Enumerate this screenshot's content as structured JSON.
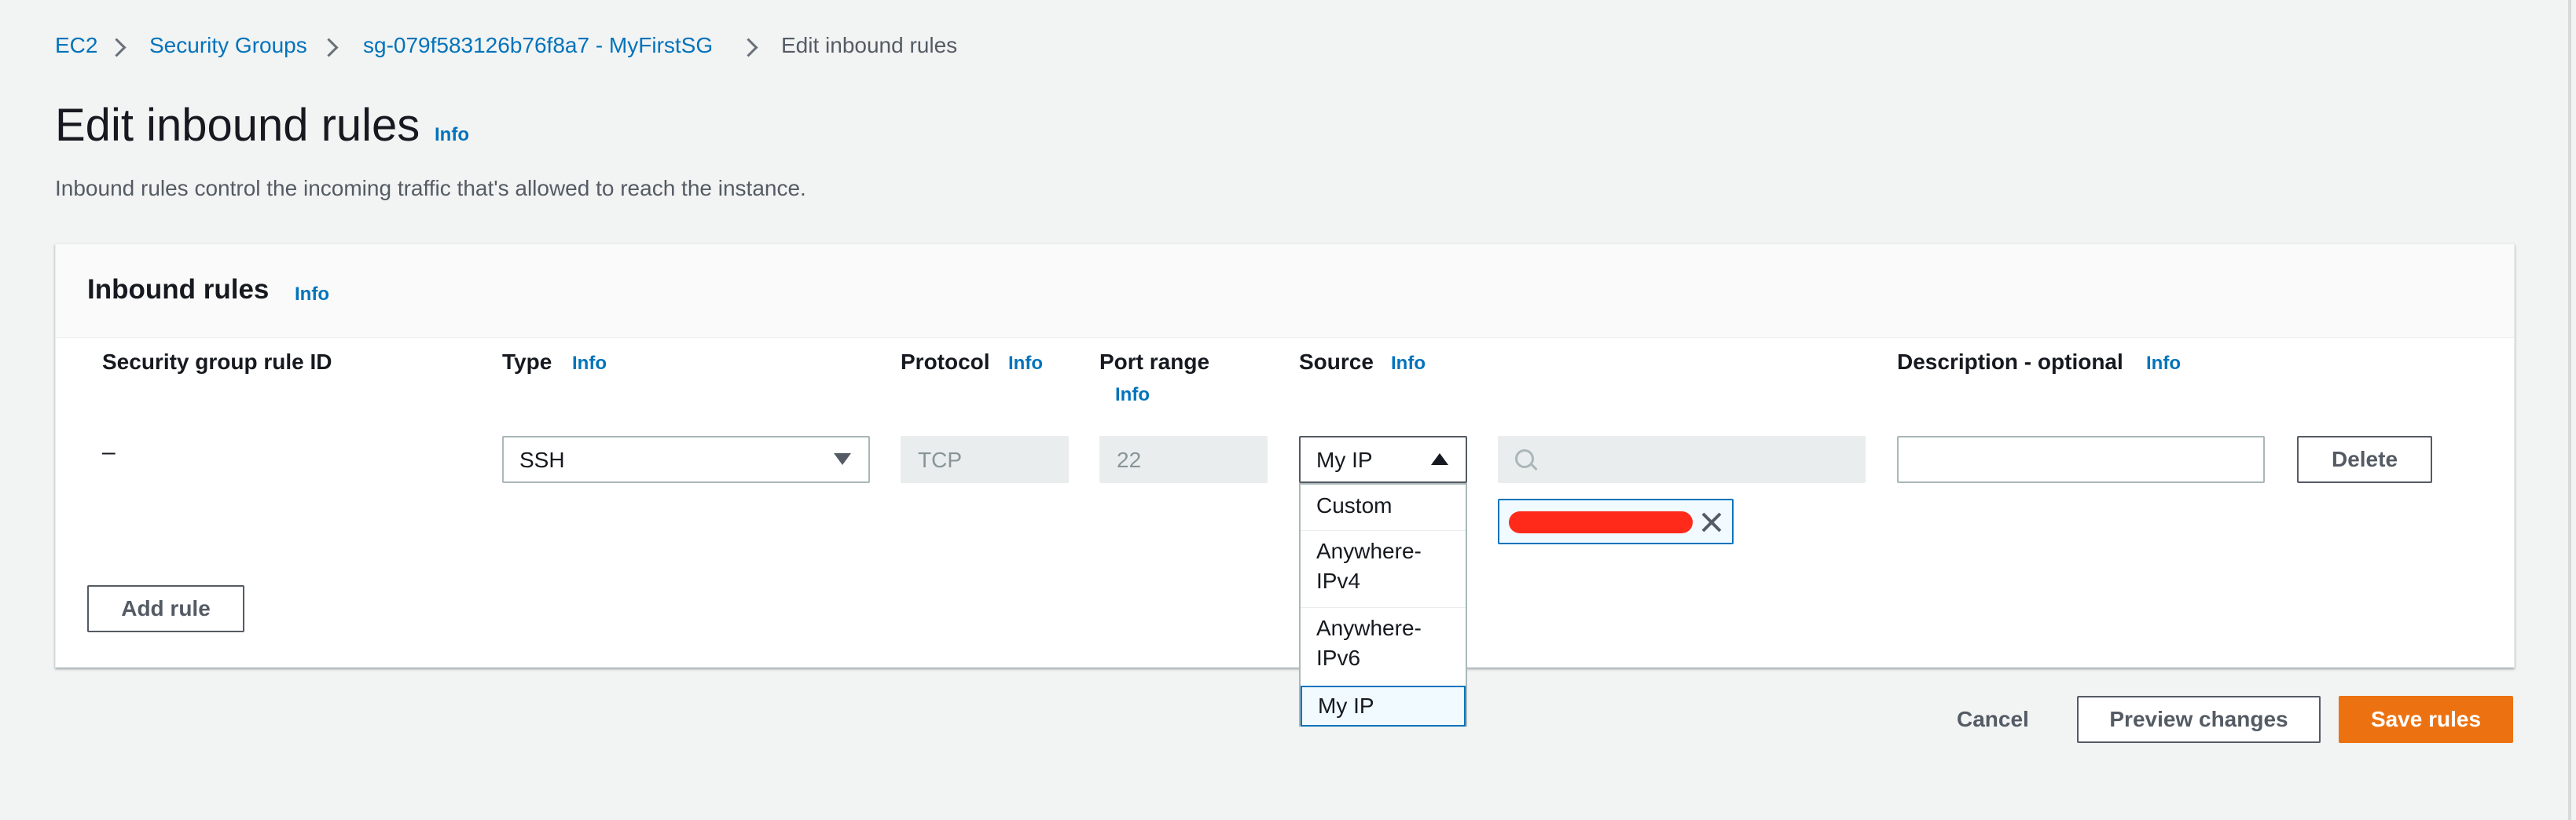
{
  "breadcrumb": {
    "items": [
      "EC2",
      "Security Groups",
      "sg-079f583126b76f8a7 - MyFirstSG"
    ],
    "current": "Edit inbound rules"
  },
  "page": {
    "title": "Edit inbound rules",
    "title_info": "Info",
    "description": "Inbound rules control the incoming traffic that's allowed to reach the instance."
  },
  "panel": {
    "title": "Inbound rules",
    "title_info": "Info",
    "columns": {
      "rule_id": "Security group rule ID",
      "type": "Type",
      "type_info": "Info",
      "protocol": "Protocol",
      "protocol_info": "Info",
      "port_range": "Port range",
      "port_range_info": "Info",
      "source": "Source",
      "source_info": "Info",
      "description": "Description - optional",
      "description_info": "Info"
    },
    "row": {
      "rule_id": "–",
      "type_value": "SSH",
      "protocol_value": "TCP",
      "port_value": "22",
      "source_value": "My IP",
      "search_placeholder": "",
      "description_value": "",
      "delete_label": "Delete"
    },
    "source_options": [
      "Custom",
      "Anywhere-IPv4",
      "Anywhere-IPv6",
      "My IP"
    ],
    "add_rule_label": "Add rule"
  },
  "footer": {
    "cancel_label": "Cancel",
    "preview_label": "Preview changes",
    "save_label": "Save rules"
  },
  "colors": {
    "accent": "#ec7211",
    "link": "#0073bb",
    "redaction": "#ff2a1a"
  }
}
